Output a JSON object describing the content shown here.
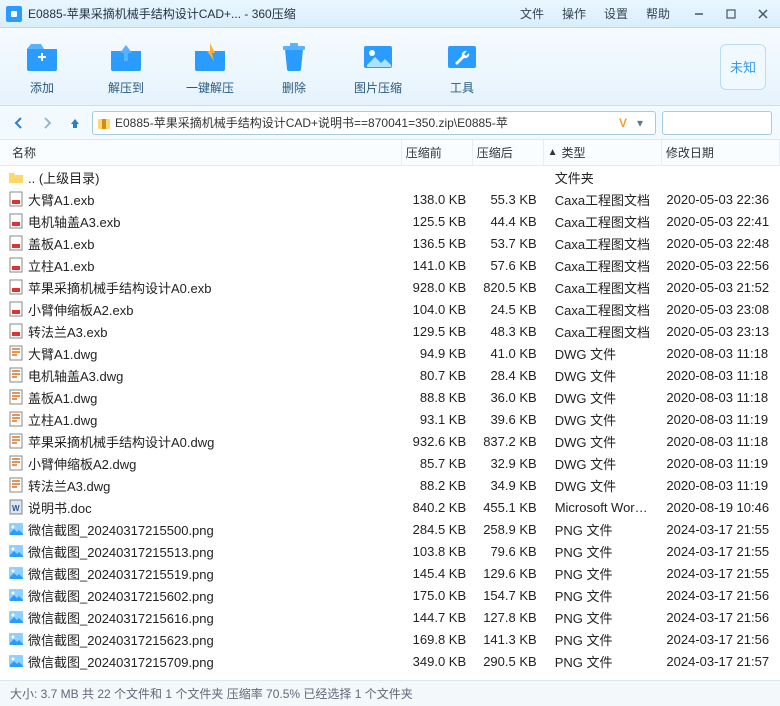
{
  "title": "E0885-苹果采摘机械手结构设计CAD+... - 360压缩",
  "menu": {
    "file": "文件",
    "operate": "操作",
    "settings": "设置",
    "help": "帮助"
  },
  "toolbar": {
    "add": "添加",
    "extract": "解压到",
    "oneclick": "一键解压",
    "delete": "删除",
    "imgcompress": "图片压缩",
    "tools": "工具",
    "badge": "未知"
  },
  "path": "E0885-苹果采摘机械手结构设计CAD+说明书==870041=350.zip\\E0885-苹",
  "columns": {
    "name": "名称",
    "before": "压缩前",
    "after": "压缩后",
    "type": "类型",
    "date": "修改日期"
  },
  "parent": ".. (上级目录)",
  "parent_type": "文件夹",
  "files": [
    {
      "icon": "exb",
      "name": "大臂A1.exb",
      "before": "138.0 KB",
      "after": "55.3 KB",
      "type": "Caxa工程图文档",
      "date": "2020-05-03 22:36"
    },
    {
      "icon": "exb",
      "name": "电机轴盖A3.exb",
      "before": "125.5 KB",
      "after": "44.4 KB",
      "type": "Caxa工程图文档",
      "date": "2020-05-03 22:41"
    },
    {
      "icon": "exb",
      "name": "盖板A1.exb",
      "before": "136.5 KB",
      "after": "53.7 KB",
      "type": "Caxa工程图文档",
      "date": "2020-05-03 22:48"
    },
    {
      "icon": "exb",
      "name": "立柱A1.exb",
      "before": "141.0 KB",
      "after": "57.6 KB",
      "type": "Caxa工程图文档",
      "date": "2020-05-03 22:56"
    },
    {
      "icon": "exb",
      "name": "苹果采摘机械手结构设计A0.exb",
      "before": "928.0 KB",
      "after": "820.5 KB",
      "type": "Caxa工程图文档",
      "date": "2020-05-03 21:52"
    },
    {
      "icon": "exb",
      "name": "小臂伸缩板A2.exb",
      "before": "104.0 KB",
      "after": "24.5 KB",
      "type": "Caxa工程图文档",
      "date": "2020-05-03 23:08"
    },
    {
      "icon": "exb",
      "name": "转法兰A3.exb",
      "before": "129.5 KB",
      "after": "48.3 KB",
      "type": "Caxa工程图文档",
      "date": "2020-05-03 23:13"
    },
    {
      "icon": "dwg",
      "name": "大臂A1.dwg",
      "before": "94.9 KB",
      "after": "41.0 KB",
      "type": "DWG 文件",
      "date": "2020-08-03 11:18"
    },
    {
      "icon": "dwg",
      "name": "电机轴盖A3.dwg",
      "before": "80.7 KB",
      "after": "28.4 KB",
      "type": "DWG 文件",
      "date": "2020-08-03 11:18"
    },
    {
      "icon": "dwg",
      "name": "盖板A1.dwg",
      "before": "88.8 KB",
      "after": "36.0 KB",
      "type": "DWG 文件",
      "date": "2020-08-03 11:18"
    },
    {
      "icon": "dwg",
      "name": "立柱A1.dwg",
      "before": "93.1 KB",
      "after": "39.6 KB",
      "type": "DWG 文件",
      "date": "2020-08-03 11:19"
    },
    {
      "icon": "dwg",
      "name": "苹果采摘机械手结构设计A0.dwg",
      "before": "932.6 KB",
      "after": "837.2 KB",
      "type": "DWG 文件",
      "date": "2020-08-03 11:18"
    },
    {
      "icon": "dwg",
      "name": "小臂伸缩板A2.dwg",
      "before": "85.7 KB",
      "after": "32.9 KB",
      "type": "DWG 文件",
      "date": "2020-08-03 11:19"
    },
    {
      "icon": "dwg",
      "name": "转法兰A3.dwg",
      "before": "88.2 KB",
      "after": "34.9 KB",
      "type": "DWG 文件",
      "date": "2020-08-03 11:19"
    },
    {
      "icon": "doc",
      "name": "说明书.doc",
      "before": "840.2 KB",
      "after": "455.1 KB",
      "type": "Microsoft Word ...",
      "date": "2020-08-19 10:46"
    },
    {
      "icon": "png",
      "name": "微信截图_20240317215500.png",
      "before": "284.5 KB",
      "after": "258.9 KB",
      "type": "PNG 文件",
      "date": "2024-03-17 21:55"
    },
    {
      "icon": "png",
      "name": "微信截图_20240317215513.png",
      "before": "103.8 KB",
      "after": "79.6 KB",
      "type": "PNG 文件",
      "date": "2024-03-17 21:55"
    },
    {
      "icon": "png",
      "name": "微信截图_20240317215519.png",
      "before": "145.4 KB",
      "after": "129.6 KB",
      "type": "PNG 文件",
      "date": "2024-03-17 21:55"
    },
    {
      "icon": "png",
      "name": "微信截图_20240317215602.png",
      "before": "175.0 KB",
      "after": "154.7 KB",
      "type": "PNG 文件",
      "date": "2024-03-17 21:56"
    },
    {
      "icon": "png",
      "name": "微信截图_20240317215616.png",
      "before": "144.7 KB",
      "after": "127.8 KB",
      "type": "PNG 文件",
      "date": "2024-03-17 21:56"
    },
    {
      "icon": "png",
      "name": "微信截图_20240317215623.png",
      "before": "169.8 KB",
      "after": "141.3 KB",
      "type": "PNG 文件",
      "date": "2024-03-17 21:56"
    },
    {
      "icon": "png",
      "name": "微信截图_20240317215709.png",
      "before": "349.0 KB",
      "after": "290.5 KB",
      "type": "PNG 文件",
      "date": "2024-03-17 21:57"
    }
  ],
  "status": "大小: 3.7 MB 共 22 个文件和 1 个文件夹 压缩率 70.5% 已经选择 1 个文件夹"
}
